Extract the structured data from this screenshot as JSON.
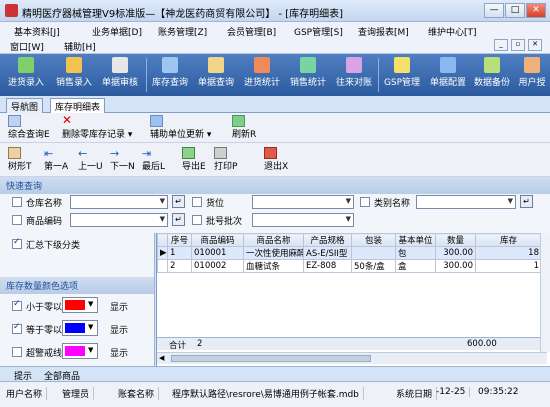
{
  "window": {
    "title": "精明医疗器械管理V9标准版—【神龙医药商贸有限公司】 - [库存明细表]",
    "min": "—",
    "max": "□",
    "close": "✕"
  },
  "menu": {
    "row1": [
      "基本资料[J]",
      "业务单据[D]",
      "账务管理[Z]",
      "会员管理[B]",
      "GSP管理[S]",
      "查询报表[M]",
      "维护中心[T]"
    ],
    "row2": [
      "窗口[W]",
      "辅助[H]"
    ]
  },
  "toolbar": [
    "进货录入",
    "销售录入",
    "单据审核",
    "库存查询",
    "单据查询",
    "进货统计",
    "销售统计",
    "往来对账",
    "GSP管理",
    "单据配置",
    "数据备份",
    "用户授"
  ],
  "tabs": [
    "导航图",
    "库存明细表"
  ],
  "actions1": [
    "综合查询E",
    "删除零库存记录",
    "辅助单位更新",
    "刷新R"
  ],
  "actions2": [
    "树形T",
    "第一A",
    "上一U",
    "下一N",
    "最后L",
    "导出E",
    "打印P",
    "退出X"
  ],
  "quick_query": {
    "title": "快速查询",
    "warehouse": "仓库名称",
    "location": "货位",
    "category": "类别名称",
    "product_code": "商品编码",
    "batch": "批号批次"
  },
  "summary_lower": "汇总下级分类",
  "color_options": {
    "title": "库存数量颜色选项",
    "rows": [
      {
        "label": "小于零以",
        "color": "#ff0000",
        "show": "显示",
        "checked": true
      },
      {
        "label": "等于零以",
        "color": "#0000ff",
        "show": "显示",
        "checked": true
      },
      {
        "label": "超警戒线",
        "color": "#ff00ff",
        "show": "显示",
        "checked": false
      }
    ]
  },
  "grid": {
    "headers": [
      "序号",
      "商品编码",
      "商品名称",
      "产品规格",
      "包装",
      "基本单位",
      "数量",
      "库存"
    ],
    "rows": [
      {
        "no": "1",
        "code": "010001",
        "name": "一次性使用麻醉穿",
        "spec": "AS-E/SII型",
        "pack": "",
        "unit": "包",
        "qty": "300.00",
        "stock": "18"
      },
      {
        "no": "2",
        "code": "010002",
        "name": "血糖试条",
        "spec": "EZ-808",
        "pack": "50条/盒",
        "unit": "盒",
        "qty": "300.00",
        "stock": "1"
      }
    ],
    "total_label": "合计",
    "total_count": "2",
    "total_qty": "600.00"
  },
  "bottom_tabs": [
    "提示",
    "全部商品"
  ],
  "status": {
    "user_label": "用户名称",
    "user": "管理员",
    "account_label": "账套名称",
    "path": "程序默认路径\\resrore\\易博通用例子帐套.mdb",
    "date_label": "系统日期",
    "date": "-12-25",
    "time": "09:35:22"
  }
}
